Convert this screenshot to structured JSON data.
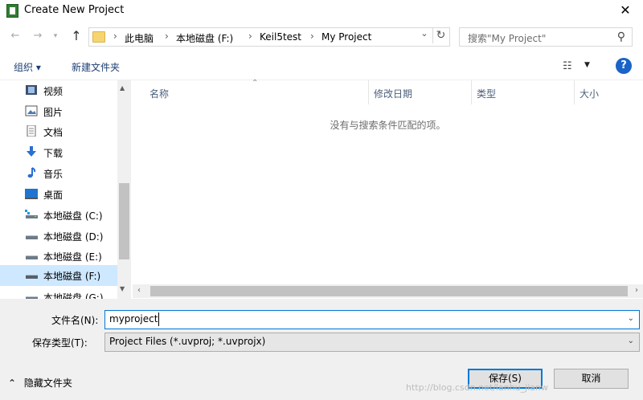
{
  "window": {
    "title": "Create New Project"
  },
  "navigation": {
    "breadcrumb": [
      "此电脑",
      "本地磁盘 (F:)",
      "Keil5test",
      "My Project"
    ]
  },
  "search": {
    "placeholder": "搜索\"My Project\""
  },
  "toolbar": {
    "organize": "组织 ▾",
    "new_folder": "新建文件夹"
  },
  "sidebar": {
    "items": [
      {
        "label": "视频",
        "icon": "video-icon"
      },
      {
        "label": "图片",
        "icon": "picture-icon"
      },
      {
        "label": "文档",
        "icon": "document-icon"
      },
      {
        "label": "下载",
        "icon": "download-icon"
      },
      {
        "label": "音乐",
        "icon": "music-icon"
      },
      {
        "label": "桌面",
        "icon": "desktop-icon"
      },
      {
        "label": "本地磁盘 (C:)",
        "icon": "drive-icon"
      },
      {
        "label": "本地磁盘 (D:)",
        "icon": "drive-icon"
      },
      {
        "label": "本地磁盘 (E:)",
        "icon": "drive-icon"
      },
      {
        "label": "本地磁盘 (F:)",
        "icon": "drive-icon",
        "selected": true
      },
      {
        "label": "本地磁盘 (G:)",
        "icon": "drive-icon"
      }
    ]
  },
  "file_list": {
    "columns": [
      "名称",
      "修改日期",
      "类型",
      "大小"
    ],
    "empty_message": "没有与搜索条件匹配的项。"
  },
  "save_form": {
    "filename_label": "文件名(N):",
    "filename_value": "myproject",
    "filetype_label": "保存类型(T):",
    "filetype_value": "Project Files (*.uvproj; *.uvprojx)",
    "hide_folders": "隐藏文件夹",
    "save_button": "保存(S)",
    "cancel_button": "取消"
  },
  "watermark": "http://blog.csdn.net/lanhu_jianw",
  "colors": {
    "accent": "#0078d7",
    "selected_bg": "#cde8ff",
    "link": "#1c3f75"
  }
}
